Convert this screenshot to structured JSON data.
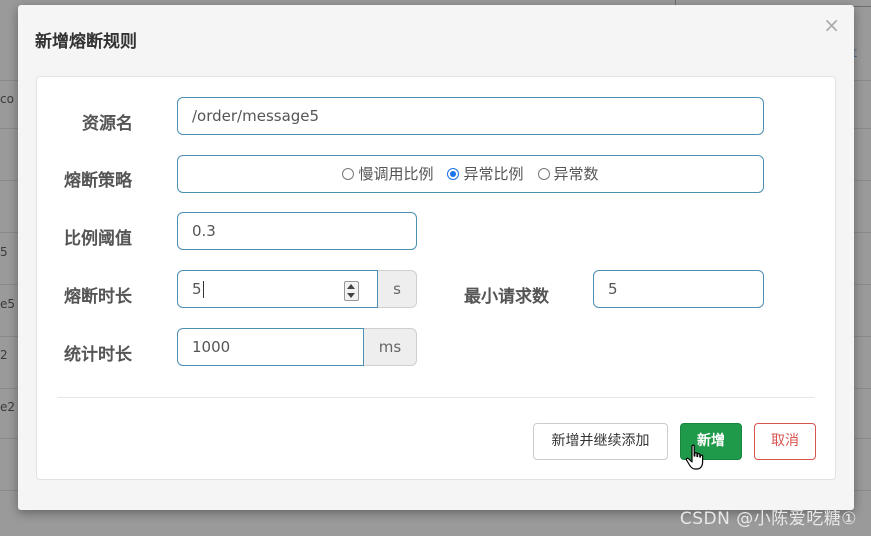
{
  "background": {
    "fragments": [
      "co",
      "5",
      "e5",
      "2",
      "e2"
    ],
    "right_fragment": "t"
  },
  "modal": {
    "title": "新增熔断规则",
    "close_symbol": "×"
  },
  "form": {
    "resource": {
      "label": "资源名",
      "value": "/order/message5"
    },
    "strategy": {
      "label": "熔断策略",
      "options": [
        "慢调用比例",
        "异常比例",
        "异常数"
      ],
      "selected": "异常比例"
    },
    "ratio": {
      "label": "比例阈值",
      "value": "0.3"
    },
    "duration": {
      "label": "熔断时长",
      "value": "5",
      "unit": "s"
    },
    "min_requests": {
      "label": "最小请求数",
      "value": "5"
    },
    "stat_interval": {
      "label": "统计时长",
      "value": "1000",
      "unit": "ms"
    }
  },
  "buttons": {
    "add_continue": "新增并继续添加",
    "add": "新增",
    "cancel": "取消"
  },
  "watermark": "CSDN @小陈爱吃糖①",
  "colors": {
    "input_border": "#4d8fb3",
    "primary": "#1f9a4a",
    "danger": "#d9534f",
    "radio_checked": "#1a73e8"
  }
}
